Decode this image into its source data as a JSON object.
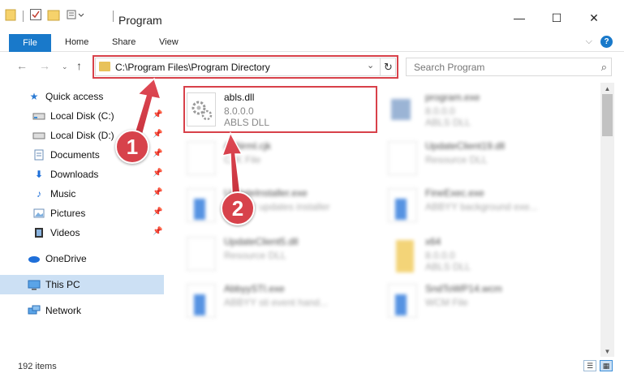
{
  "window": {
    "title": "Program",
    "minimize_glyph": "—",
    "maximize_glyph": "☐",
    "close_glyph": "✕"
  },
  "ribbon": {
    "tabs": [
      "File",
      "Home",
      "Share",
      "View"
    ],
    "help": "?"
  },
  "address": {
    "path": "C:\\Program Files\\Program Directory"
  },
  "search": {
    "placeholder": "Search Program"
  },
  "sidebar": {
    "items": [
      {
        "label": "Quick access",
        "icon": "star-icon"
      },
      {
        "label": "Local Disk (C:)",
        "icon": "drive-icon"
      },
      {
        "label": "Local Disk (D:)",
        "icon": "drive-icon"
      },
      {
        "label": "Documents",
        "icon": "documents-icon"
      },
      {
        "label": "Downloads",
        "icon": "downloads-icon"
      },
      {
        "label": "Music",
        "icon": "music-icon"
      },
      {
        "label": "Pictures",
        "icon": "pictures-icon"
      },
      {
        "label": "Videos",
        "icon": "videos-icon"
      },
      {
        "label": "OneDrive",
        "icon": "cloud-icon"
      },
      {
        "label": "This PC",
        "icon": "computer-icon"
      },
      {
        "label": "Network",
        "icon": "network-icon"
      }
    ]
  },
  "files": [
    {
      "name": "abls.dll",
      "version": "8.0.0.0",
      "desc": "ABLS DLL"
    },
    {
      "name": "program.exe",
      "version": "8.0.0.0",
      "desc": "ABLS DLL"
    },
    {
      "name": "AbNrml.cjk",
      "version": "",
      "desc": "CJK File"
    },
    {
      "name": "UpdateClient19.dll",
      "version": "",
      "desc": "Resource DLL"
    },
    {
      "name": "UpdateInstaller.exe",
      "version": "",
      "desc": "ABBYY updates installer"
    },
    {
      "name": "FineExec.exe",
      "version": "",
      "desc": "ABBYY background exe..."
    },
    {
      "name": "UpdateClient5.dll",
      "version": "",
      "desc": "Resource DLL"
    },
    {
      "name": "x64",
      "version": "8.0.0.0",
      "desc": "ABLS DLL"
    },
    {
      "name": "AbbyySTI.exe",
      "version": "",
      "desc": "ABBYY sti event hand..."
    },
    {
      "name": "SndToWP14.wcm",
      "version": "",
      "desc": "WCM File"
    }
  ],
  "status": {
    "item_count": "192 items"
  },
  "annotations": {
    "badge1": "1",
    "badge2": "2"
  },
  "colors": {
    "accent": "#1979ca",
    "highlight": "#d8414a",
    "selection": "#cce0f4"
  }
}
